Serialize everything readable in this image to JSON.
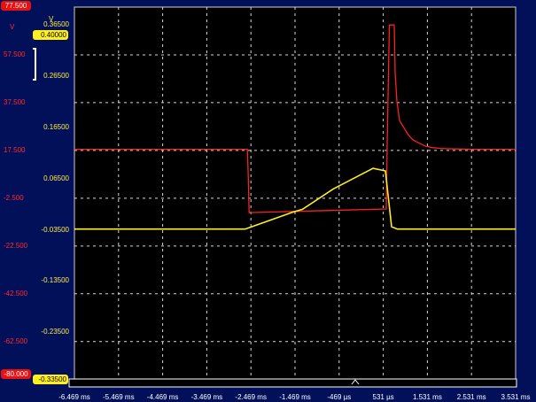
{
  "chart_data": {
    "type": "line",
    "xlabel": "",
    "x_ticks": [
      "-6.469 ms",
      "-5.469 ms",
      "-4.469 ms",
      "-3.469 ms",
      "-2.469 ms",
      "-1.469 ms",
      "-469 µs",
      "531 µs",
      "1.531 ms",
      "2.531 ms",
      "3.531 ms"
    ],
    "xlim_ms": [
      -6.469,
      3.531
    ],
    "axes": {
      "red": {
        "unit": "V",
        "top_label": "77.500",
        "bottom_label": "-80.000",
        "ticks": [
          "57.500",
          "37.500",
          "17.500",
          "-2.500",
          "-22.500",
          "-42.500",
          "-62.500"
        ],
        "ylim": [
          -80.0,
          77.5
        ],
        "color": "#ff2020"
      },
      "yellow": {
        "unit": "V",
        "top_label": "0.40000",
        "bottom_label": "-0.33500",
        "ticks": [
          "0.36500",
          "0.26500",
          "0.16500",
          "0.06500",
          "-0.03500",
          "-0.13500",
          "-0.23500"
        ],
        "ylim": [
          -0.335,
          0.4
        ],
        "color": "#ffee20"
      }
    },
    "series": [
      {
        "axis": "red",
        "x": [
          -6.469,
          -2.55,
          -2.53,
          -2.51,
          0.6,
          0.62,
          0.67,
          0.78,
          0.8,
          0.84,
          0.9,
          1.0,
          1.1,
          1.2,
          1.35,
          1.45,
          1.5,
          1.65,
          1.8,
          2.0,
          2.3,
          2.6,
          3.0,
          3.531
        ],
        "y": [
          18.0,
          18.0,
          7.0,
          -8.5,
          -7.0,
          20.0,
          70.0,
          70.0,
          50.0,
          38.0,
          30.0,
          27.0,
          24.0,
          22.0,
          20.5,
          19.6,
          19.2,
          18.7,
          18.4,
          18.2,
          18.1,
          18.0,
          18.0,
          18.0
        ]
      },
      {
        "axis": "yellow",
        "x": [
          -6.469,
          -2.6,
          -1.5,
          -1.3,
          -0.6,
          0.3,
          0.58,
          0.72,
          0.85,
          1.0,
          2.15,
          2.25,
          2.35,
          3.531
        ],
        "y": [
          -0.0335,
          -0.0335,
          0.0,
          0.005,
          0.045,
          0.085,
          0.08,
          -0.029,
          -0.0335,
          -0.0335,
          -0.0335,
          -0.0335,
          -0.0335,
          -0.0335
        ]
      }
    ],
    "grid": true,
    "legend": "none"
  }
}
